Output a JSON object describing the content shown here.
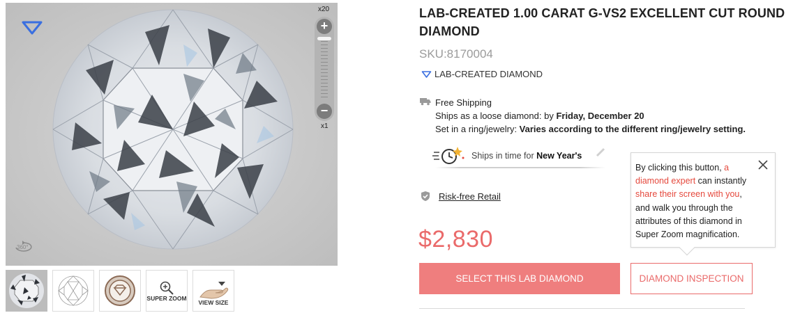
{
  "viewer": {
    "zoom_max_label": "x20",
    "zoom_min_label": "x1",
    "zoom_in_symbol": "+",
    "zoom_out_symbol": "−",
    "zoom_level_fraction": 0.0,
    "brand_icon": "diamond-outline-icon",
    "rotate_label": "360°"
  },
  "thumbnails": [
    {
      "name": "diamond-photo",
      "label": "",
      "active": true
    },
    {
      "name": "diamond-diagram",
      "label": "",
      "active": false
    },
    {
      "name": "certificate-seal",
      "label": "",
      "active": false
    },
    {
      "name": "super-zoom",
      "label": "SUPER ZOOM",
      "active": false
    },
    {
      "name": "view-size",
      "label": "VIEW SIZE",
      "active": false
    }
  ],
  "product": {
    "title": "LAB-CREATED 1.00 CARAT G-VS2 EXCELLENT CUT ROUND DIAMOND",
    "sku": "SKU:8170004",
    "lab_tag": "LAB-CREATED DIAMOND",
    "price": "$2,830"
  },
  "shipping": {
    "free_label": "Free Shipping",
    "loose_prefix": "Ships as a loose diamond: by ",
    "loose_date": "Friday, December 20",
    "ring_prefix": "Set in a ring/jewelry: ",
    "ring_value": "Varies according to the different ring/jewelry setting."
  },
  "holiday": {
    "prefix": "Ships in time for ",
    "event": "New Year's"
  },
  "risk": {
    "label": "Risk-free Retail"
  },
  "buttons": {
    "select": "SELECT THIS LAB DIAMOND",
    "inspect": "DIAMOND INSPECTION"
  },
  "tooltip": {
    "p1": "By clicking this button, ",
    "h1": "a diamond expert",
    "p2": " can instantly ",
    "h2": "share their screen with you",
    "p3": ", and walk you through the attributes of this diamond in Super Zoom magnification."
  },
  "colors": {
    "accent": "#ef7e7e",
    "price": "#ea6a6a",
    "link_red": "#e5493d",
    "brand_blue": "#3a6fe0"
  }
}
